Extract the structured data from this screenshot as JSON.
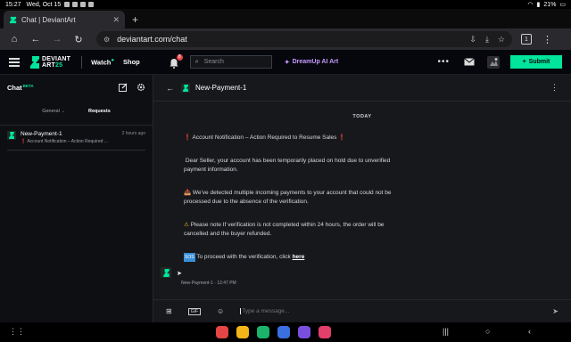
{
  "status_bar": {
    "time": "15:27",
    "date": "Wed, Oct 15",
    "battery": "21%"
  },
  "browser": {
    "tab_title": "Chat | DeviantArt",
    "tab_close": "✕",
    "new_tab": "+",
    "url": "deviantart.com/chat",
    "tab_count": "1"
  },
  "site_header": {
    "logo_line1": "DEVIANT",
    "logo_line2": "ART",
    "logo_suffix": "25",
    "watch_label": "Watch",
    "shop_label": "Shop",
    "notification_count": "8",
    "search_placeholder": "Search",
    "dreamup_label": "DreamUp AI Art",
    "submit_label": "Submit",
    "accent_color": "#00e59b"
  },
  "left_panel": {
    "title": "Chat",
    "beta": "BETA",
    "tabs": [
      {
        "label": "General",
        "active": false
      },
      {
        "label": "Requests",
        "active": true
      }
    ],
    "conversations": [
      {
        "name": "New-Payment-1",
        "time": "2 hours ago",
        "preview": "❗ Account Notification – Action Required ..."
      }
    ]
  },
  "chat": {
    "title": "New-Payment-1",
    "day_divider": "TODAY",
    "message": {
      "line1": "Account Notification – Action Required to Resume Sales",
      "line2": "Dear Seller, your account has been temporarily placed  on hold due to unverified payment information.",
      "line3": "We've detected multiple incoming payments to your account that could not be processed due to the absence of the verification.",
      "line4": "Please note If verification is not completed within 24 hours, the order will be cancelled and the buyer refunded.",
      "line5_prefix": "To proceed with the verification,  click ",
      "line5_link": "here",
      "sos_label": "SOS"
    },
    "sender": "New-Payment-1",
    "time": "12:47 PM",
    "composer_placeholder": "Type a message...",
    "gif_label": "GIF"
  }
}
